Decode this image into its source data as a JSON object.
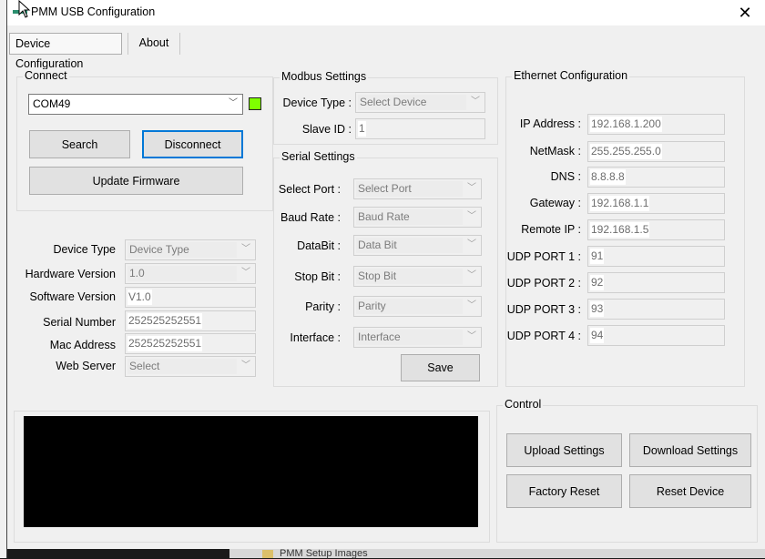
{
  "window": {
    "title": "PMM USB Configuration",
    "close_icon": "close-icon"
  },
  "tabs": [
    {
      "label": "Device Configuration",
      "active": true
    },
    {
      "label": "About",
      "active": false
    }
  ],
  "connect": {
    "title": "Connect",
    "port_value": "COM49",
    "status_color": "#7fff00",
    "search_label": "Search",
    "disconnect_label": "Disconnect",
    "update_firmware_label": "Update Firmware"
  },
  "device_info": {
    "device_type_label": "Device Type",
    "device_type_value": "Device Type",
    "hardware_version_label": "Hardware Version",
    "hardware_version_value": "1.0",
    "software_version_label": "Software Version",
    "software_version_value": "V1.0",
    "serial_number_label": "Serial Number",
    "serial_number_value": "252525252551",
    "mac_address_label": "Mac Address",
    "mac_address_value": "252525252551",
    "web_server_label": "Web Server",
    "web_server_value": "Select"
  },
  "modbus": {
    "title": "Modbus Settings",
    "device_type_label": "Device Type :",
    "device_type_value": "Select Device",
    "slave_id_label": "Slave ID :",
    "slave_id_value": "1"
  },
  "serial": {
    "title": "Serial Settings",
    "select_port_label": "Select Port :",
    "select_port_value": "Select Port",
    "baud_rate_label": "Baud Rate :",
    "baud_rate_value": "Baud Rate",
    "databit_label": "DataBit :",
    "databit_value": "Data Bit",
    "stop_bit_label": "Stop Bit :",
    "stop_bit_value": "Stop Bit",
    "parity_label": "Parity :",
    "parity_value": "Parity",
    "interface_label": "Interface :",
    "interface_value": "Interface",
    "save_label": "Save"
  },
  "ethernet": {
    "title": "Ethernet Configuration",
    "ip_address_label": "IP Address :",
    "ip_address_value": "192.168.1.200",
    "netmask_label": "NetMask :",
    "netmask_value": "255.255.255.0",
    "dns_label": "DNS :",
    "dns_value": "8.8.8.8",
    "gateway_label": "Gateway :",
    "gateway_value": "192.168.1.1",
    "remote_ip_label": "Remote IP :",
    "remote_ip_value": "192.168.1.5",
    "udp1_label": "UDP PORT 1 :",
    "udp1_value": "91",
    "udp2_label": "UDP PORT 2 :",
    "udp2_value": "92",
    "udp3_label": "UDP PORT 3 :",
    "udp3_value": "93",
    "udp4_label": "UDP PORT 4 :",
    "udp4_value": "94"
  },
  "control": {
    "title": "Control",
    "upload_label": "Upload Settings",
    "download_label": "Download Settings",
    "factory_reset_label": "Factory Reset",
    "reset_device_label": "Reset Device"
  },
  "background": {
    "taskbar_text": "PMM Setup Images"
  }
}
